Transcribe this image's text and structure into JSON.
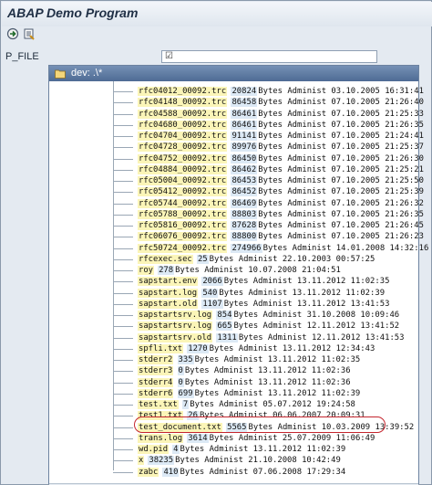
{
  "window": {
    "title": "ABAP Demo Program"
  },
  "toolbar": {
    "execute_icon": "execute-icon",
    "variant_icon": "variant-icon"
  },
  "param": {
    "label": "P_FILE",
    "value": "☑"
  },
  "popup": {
    "title": "dev: .\\*"
  },
  "files": [
    {
      "name": "rfc04012_00092.trc",
      "size": "20824",
      "rest": " Bytes Administ 03.10.2005 16:31:41"
    },
    {
      "name": "rfc04148_00092.trc",
      "size": "86458",
      "rest": " Bytes Administ 07.10.2005 21:26:40"
    },
    {
      "name": "rfc04588_00092.trc",
      "size": "86461",
      "rest": " Bytes Administ 07.10.2005 21:25:33"
    },
    {
      "name": "rfc04680_00092.trc",
      "size": "86461",
      "rest": " Bytes Administ 07.10.2005 21:26:35"
    },
    {
      "name": "rfc04704_00092.trc",
      "size": "91141",
      "rest": " Bytes Administ 07.10.2005 21:24:41"
    },
    {
      "name": "rfc04728_00092.trc",
      "size": "89976",
      "rest": " Bytes Administ 07.10.2005 21:25:37"
    },
    {
      "name": "rfc04752_00092.trc",
      "size": "86450",
      "rest": " Bytes Administ 07.10.2005 21:26:30"
    },
    {
      "name": "rfc04884_00092.trc",
      "size": "86462",
      "rest": " Bytes Administ 07.10.2005 21:25:21"
    },
    {
      "name": "rfc05004_00092.trc",
      "size": "86453",
      "rest": " Bytes Administ 07.10.2005 21:25:50"
    },
    {
      "name": "rfc05412_00092.trc",
      "size": "86452",
      "rest": " Bytes Administ 07.10.2005 21:25:39"
    },
    {
      "name": "rfc05744_00092.trc",
      "size": "86469",
      "rest": " Bytes Administ 07.10.2005 21:26:32"
    },
    {
      "name": "rfc05788_00092.trc",
      "size": "88803",
      "rest": " Bytes Administ 07.10.2005 21:26:35"
    },
    {
      "name": "rfc05816_00092.trc",
      "size": "87628",
      "rest": " Bytes Administ 07.10.2005 21:26:45"
    },
    {
      "name": "rfc06076_00092.trc",
      "size": "88800",
      "rest": " Bytes Administ 07.10.2005 21:26:23"
    },
    {
      "name": "rfc50724_00092.trc",
      "size": "274966",
      "rest": " Bytes Administ 14.01.2008 14:32:16"
    },
    {
      "name": "rfcexec.sec",
      "size": "25",
      "rest": " Bytes Administ 22.10.2003 00:57:25"
    },
    {
      "name": "roy",
      "size": "278",
      "rest": " Bytes Administ 10.07.2008 21:04:51"
    },
    {
      "name": "sapstart.env",
      "size": "2066",
      "rest": " Bytes Administ 13.11.2012 11:02:35"
    },
    {
      "name": "sapstart.log",
      "size": "540",
      "rest": " Bytes Administ 13.11.2012 11:02:39"
    },
    {
      "name": "sapstart.old",
      "size": "1107",
      "rest": " Bytes Administ 13.11.2012 13:41:53"
    },
    {
      "name": "sapstartsrv.log",
      "size": "854",
      "rest": " Bytes Administ 31.10.2008 10:09:46"
    },
    {
      "name": "sapstartsrv.log",
      "size": "665",
      "rest": " Bytes Administ 12.11.2012 13:41:52"
    },
    {
      "name": "sapstartsrv.old",
      "size": "1311",
      "rest": " Bytes Administ 12.11.2012 13:41:53"
    },
    {
      "name": "spfli.txt",
      "size": "1270",
      "rest": " Bytes Administ 13.11.2012 12:34:43"
    },
    {
      "name": "stderr2",
      "size": "335",
      "rest": " Bytes Administ 13.11.2012 11:02:35"
    },
    {
      "name": "stderr3",
      "size": "0",
      "rest": " Bytes Administ 13.11.2012 11:02:36"
    },
    {
      "name": "stderr4",
      "size": "0",
      "rest": " Bytes Administ 13.11.2012 11:02:36"
    },
    {
      "name": "stderr6",
      "size": "699",
      "rest": " Bytes Administ 13.11.2012 11:02:39"
    },
    {
      "name": "test.txt",
      "size": "7",
      "rest": " Bytes Administ 05.07.2012 19:24:58"
    },
    {
      "name": "test1.txt",
      "size": "26",
      "rest": " Bytes Administ 06.06.2007 20:09:31"
    },
    {
      "name": "test_document.txt",
      "size": "5565",
      "rest": " Bytes Administ 10.03.2009 13:39:52"
    },
    {
      "name": "trans.log",
      "size": "3614",
      "rest": " Bytes Administ 25.07.2009 11:06:49"
    },
    {
      "name": "wd.pid",
      "size": "4",
      "rest": " Bytes Administ 13.11.2012 11:02:39"
    },
    {
      "name": "x",
      "size": "38235",
      "rest": " Bytes Administ 21.10.2008 10:42:49"
    },
    {
      "name": "zabc",
      "size": "410",
      "rest": " Bytes Administ 07.06.2008 17:29:34"
    }
  ],
  "colors": {
    "name_bg": "#fbf5b8",
    "size_bg": "#dce9f5",
    "highlight_ring": "#c4262e",
    "popup_header": "#5d79a3"
  }
}
